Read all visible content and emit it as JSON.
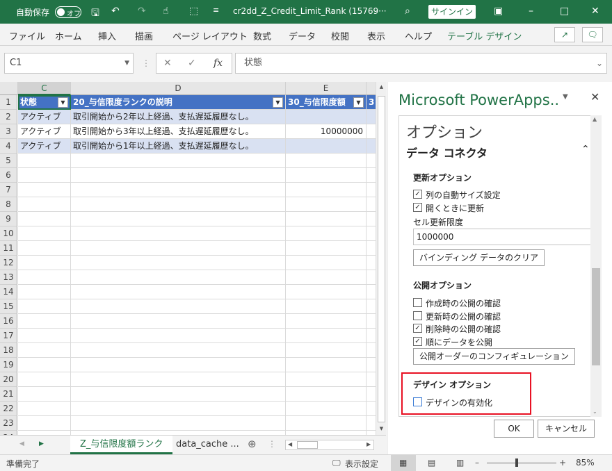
{
  "titlebar": {
    "autosave_label": "自動保存",
    "autosave_state": "オフ",
    "filename": "cr2dd_Z_Credit_Limit_Rank (15769···",
    "signin_label": "サインイン"
  },
  "ribbon": {
    "tabs": [
      "ファイル",
      "ホーム",
      "挿入",
      "描画",
      "ページ レイアウト",
      "数式",
      "データ",
      "校閲",
      "表示",
      "ヘルプ",
      "テーブル デザイン"
    ],
    "active_tab": "テーブル デザイン"
  },
  "formula_bar": {
    "name_box": "C1",
    "fx_label": "fx",
    "formula": "状態"
  },
  "grid": {
    "columns": [
      "C",
      "D",
      "E"
    ],
    "rows": [
      "1",
      "2",
      "3",
      "4",
      "5",
      "6",
      "7",
      "8",
      "9",
      "10",
      "11",
      "12",
      "13",
      "14",
      "15",
      "16",
      "17",
      "18",
      "19",
      "20",
      "21",
      "22",
      "23",
      "24"
    ],
    "header_cells": [
      "状態",
      "20_与信限度ランクの説明",
      "30_与信限度額",
      "3"
    ],
    "data": [
      [
        "アクティブ",
        "取引開始から2年以上経過、支払遅延履歴なし。",
        ""
      ],
      [
        "アクティブ",
        "取引開始から3年以上経過、支払遅延履歴なし。",
        "10000000"
      ],
      [
        "アクティブ",
        "取引開始から1年以上経過、支払遅延履歴なし。",
        ""
      ]
    ]
  },
  "sheets": {
    "tabs": [
      "Z_与信限度額ランク",
      "data_cache ..."
    ],
    "active": "Z_与信限度額ランク"
  },
  "status": {
    "ready": "準備完了",
    "display_settings": "表示設定",
    "zoom": "85%"
  },
  "pane": {
    "title": "Microsoft PowerApps..",
    "options_heading": "オプション",
    "connector_heading": "データ コネクタ",
    "refresh_section": "更新オプション",
    "autosize_label": "列の自動サイズ設定",
    "autosize_checked": true,
    "refresh_on_open_label": "開くときに更新",
    "refresh_on_open_checked": true,
    "cell_limit_label": "セル更新限度",
    "cell_limit_value": "1000000",
    "clear_binding_button": "バインディング データのクリア",
    "publish_section": "公開オプション",
    "publish_items": [
      {
        "label": "作成時の公開の確認",
        "checked": false
      },
      {
        "label": "更新時の公開の確認",
        "checked": false
      },
      {
        "label": "削除時の公開の確認",
        "checked": true
      },
      {
        "label": "順にデータを公開",
        "checked": true
      }
    ],
    "publish_order_button": "公開オーダーのコンフィギュレーション",
    "design_section": "デザイン オプション",
    "design_enable_label": "デザインの有効化",
    "design_enable_checked": false,
    "ok_button": "OK",
    "cancel_button": "キャンセル"
  }
}
